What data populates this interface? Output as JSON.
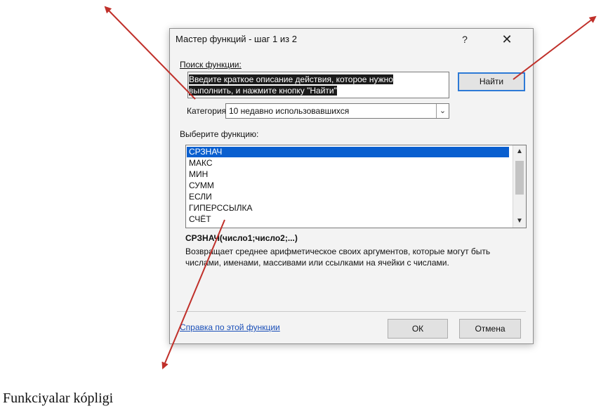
{
  "dialog": {
    "title": "Мастер функций - шаг 1 из 2",
    "help_glyph": "?",
    "close_glyph": "✕",
    "search_label": "Поиск функции:",
    "search_text_line1": "Введите краткое описание действия, которое нужно",
    "search_text_line2": "выполнить, и нажмите кнопку \"Найти\"",
    "find_button": "Найти",
    "category_label": "Категория:",
    "category_value": "10 недавно использовавшихся",
    "select_function_label": "Выберите функцию:",
    "functions": [
      "СРЗНАЧ",
      "МАКС",
      "МИН",
      "СУММ",
      "ЕСЛИ",
      "ГИПЕРССЫЛКА",
      "СЧЁТ"
    ],
    "selected_function": "СРЗНАЧ",
    "syntax": "СРЗНАЧ(число1;число2;...)",
    "description": "Возвращает среднее арифметическое своих аргументов, которые могут быть числами, именами, массивами или ссылками на ячейки с числами.",
    "help_link": "Справка по этой функции",
    "ok_button": "ОК",
    "cancel_button": "Отмена"
  },
  "caption": "Funkciyalar kópligi",
  "colors": {
    "dialog_bg": "#f3f3f3",
    "selection": "#0a5fcf",
    "arrow": "#c0302a",
    "link": "#1a4fb8"
  }
}
